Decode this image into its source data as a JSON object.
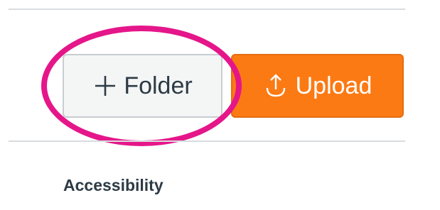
{
  "toolbar": {
    "folder_label": "Folder",
    "folder_icon": "plus-icon",
    "upload_label": "Upload",
    "upload_icon": "upload-icon"
  },
  "sidebar": {
    "accessibility_label": "Accessibility"
  },
  "colors": {
    "upload_bg": "#fc7a14",
    "highlight": "#e5168a",
    "text": "#2d3b45"
  }
}
